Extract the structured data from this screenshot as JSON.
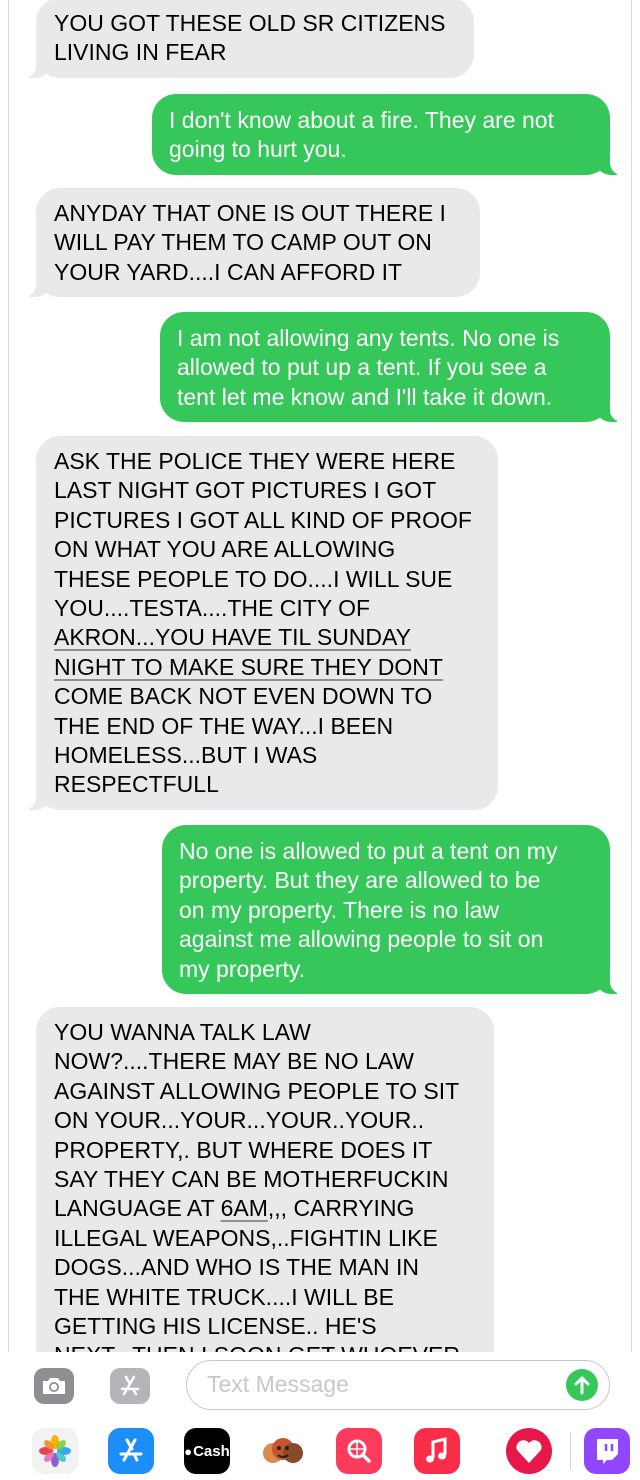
{
  "messages": [
    {
      "side": "in",
      "lines": [
        "YOU GOT THESE OLD SR CITIZENS",
        "LIVING IN FEAR"
      ]
    },
    {
      "side": "out",
      "lines": [
        "I don't know about a fire. They are not",
        "going to hurt you."
      ]
    },
    {
      "side": "in",
      "lines": [
        "ANYDAY THAT ONE IS OUT THERE I",
        "WILL PAY THEM TO CAMP OUT ON",
        "YOUR YARD....I CAN AFFORD IT"
      ]
    },
    {
      "side": "out",
      "lines": [
        "I am not allowing any tents. No one is",
        "allowed to put up a tent. If you see a",
        "tent let me know and I'll take it down."
      ]
    },
    {
      "side": "in",
      "lines": [
        "ASK THE POLICE THEY WERE HERE",
        "LAST NIGHT GOT PICTURES I GOT",
        "PICTURES I GOT ALL KIND OF PROOF",
        "ON WHAT YOU ARE ALLOWING",
        "THESE PEOPLE TO DO....I WILL SUE",
        "YOU....TESTA....THE CITY OF",
        "AKRON...YOU HAVE TIL SUNDAY",
        "NIGHT TO MAKE SURE THEY DONT",
        "COME BACK NOT EVEN DOWN TO",
        "THE END OF THE WAY...I BEEN",
        "HOMELESS...BUT I WAS",
        "RESPECTFULL"
      ]
    },
    {
      "side": "out",
      "lines": [
        "No one is allowed to put a tent on my",
        "property. But they are allowed to be",
        "on my property. There is no law",
        "against me allowing people to sit on",
        "my property."
      ]
    },
    {
      "side": "in",
      "lines": [
        "YOU WANNA TALK LAW",
        "NOW?....THERE MAY BE NO LAW",
        "AGAINST ALLOWING PEOPLE TO SIT",
        "ON YOUR...YOUR...YOUR..YOUR..",
        "PROPERTY,. BUT WHERE DOES IT",
        "SAY THEY CAN BE MOTHERFUCKIN",
        "LANGUAGE AT 6AM,,, CARRYING",
        "ILLEGAL WEAPONS,..FIGHTIN LIKE",
        "DOGS...AND WHO IS THE MAN IN",
        "THE WHITE TRUCK....I WILL BE",
        "GETTING HIS LICENSE.. HE'S",
        "NEXT...THEN I SOON GET WHOEVER"
      ]
    }
  ],
  "input_bar": {
    "placeholder": "Text Message",
    "camera_icon": "camera-icon",
    "apps_icon": "app-store-icon",
    "send_icon": "send-arrow-icon"
  },
  "app_strip": {
    "apps": [
      {
        "name": "photos-icon"
      },
      {
        "name": "app-store-icon"
      },
      {
        "name": "cash-app-icon",
        "label": "Cash"
      },
      {
        "name": "memoji-icon"
      },
      {
        "name": "web-search-icon"
      },
      {
        "name": "music-icon"
      },
      {
        "name": "heart-sticker-icon"
      },
      {
        "name": "twitch-icon"
      }
    ]
  },
  "colors": {
    "incoming_bubble": "#e9e9eb",
    "outgoing_bubble": "#35c759",
    "incoming_text": "#000000",
    "outgoing_text": "#ffffff"
  }
}
